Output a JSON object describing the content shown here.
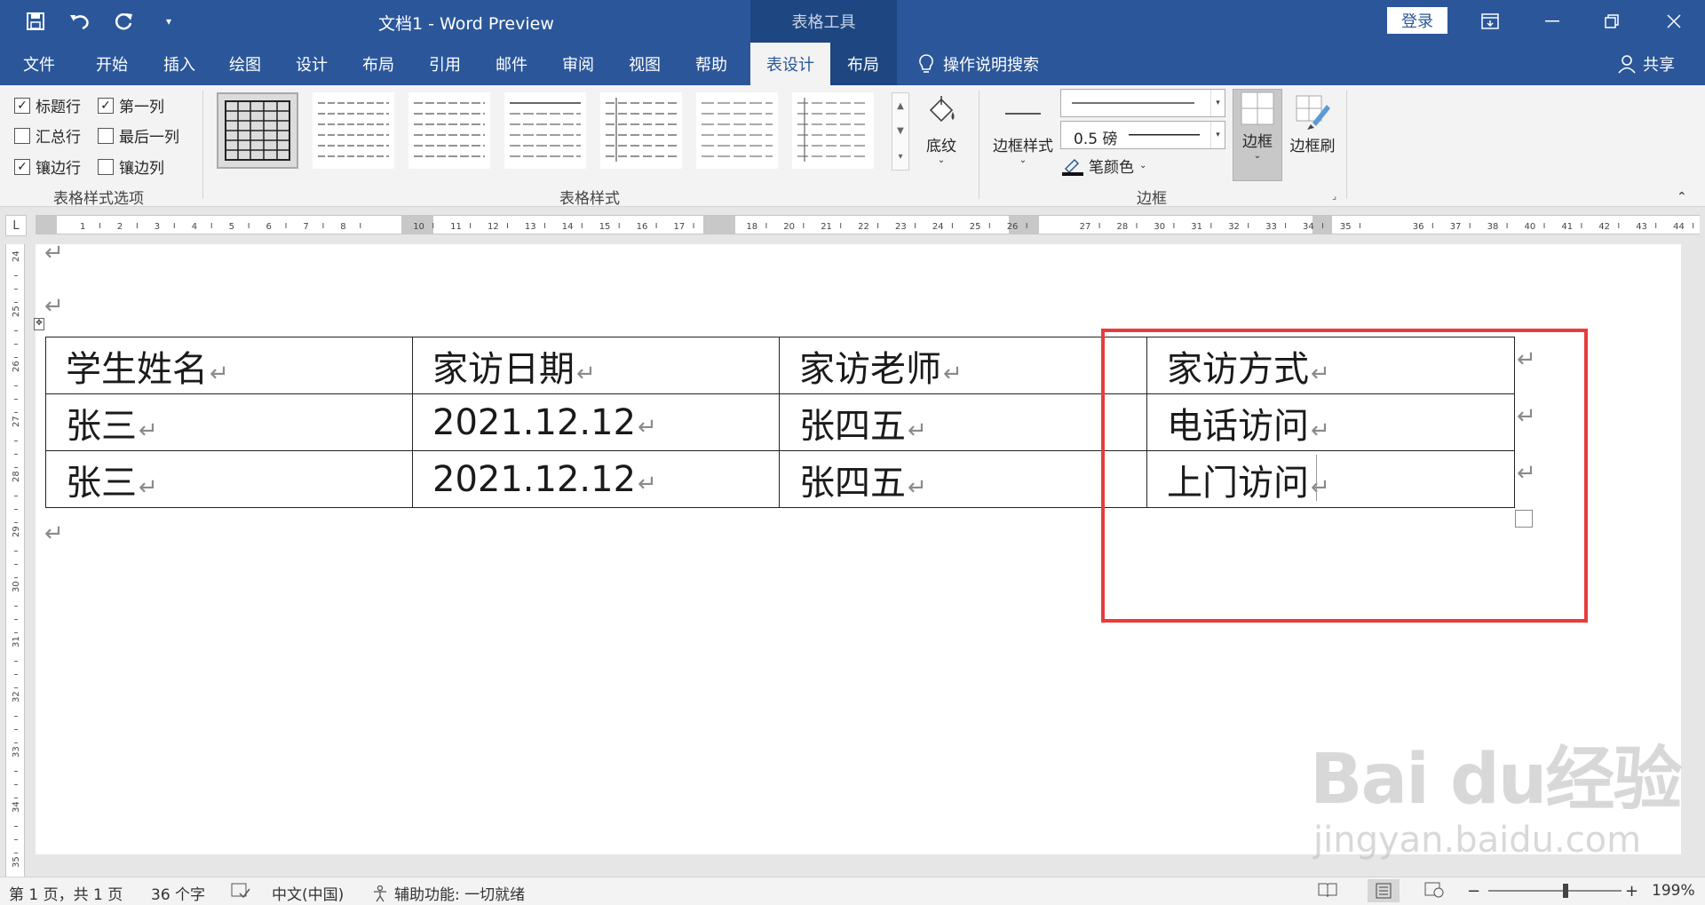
{
  "titlebar": {
    "doc_title": "文档1  -  Word Preview",
    "context_tab": "表格工具",
    "login": "登录",
    "qat_icons": [
      "save-icon",
      "undo-icon",
      "redo-icon",
      "customize-icon"
    ]
  },
  "tabs": [
    "文件",
    "开始",
    "插入",
    "绘图",
    "设计",
    "布局",
    "引用",
    "邮件",
    "审阅",
    "视图",
    "帮助",
    "表设计",
    "布局"
  ],
  "active_tab": "表设计",
  "tellme": "操作说明搜索",
  "share": "共享",
  "ribbon": {
    "style_options": {
      "label": "表格样式选项",
      "items": [
        {
          "label": "标题行",
          "checked": true
        },
        {
          "label": "第一列",
          "checked": true
        },
        {
          "label": "汇总行",
          "checked": false
        },
        {
          "label": "最后一列",
          "checked": false
        },
        {
          "label": "镶边行",
          "checked": true
        },
        {
          "label": "镶边列",
          "checked": false
        }
      ]
    },
    "table_styles": {
      "label": "表格样式",
      "shading": "底纹"
    },
    "borders": {
      "label": "边框",
      "border_styles": "边框样式",
      "weight": "0.5 磅",
      "pen_color": "笔颜色",
      "border_btn": "边框",
      "painter": "边框刷"
    }
  },
  "table": {
    "rows": [
      [
        "学生姓名",
        "家访日期",
        "家访老师",
        "家访方式"
      ],
      [
        "张三",
        "2021.12.12",
        "张四五",
        "电话访问"
      ],
      [
        "张三",
        "2021.12.12",
        "张四五",
        "上门访问"
      ]
    ]
  },
  "paragraph_mark": "↵",
  "ruler": {
    "h_ticks": [
      "1",
      "2",
      "3",
      "4",
      "5",
      "6",
      "7",
      "8",
      "10",
      "11",
      "12",
      "13",
      "14",
      "15",
      "16",
      "17",
      "18",
      "20",
      "21",
      "22",
      "23",
      "24",
      "25",
      "26",
      "27",
      "28",
      "30",
      "31",
      "32",
      "33",
      "34",
      "35",
      "36",
      "37",
      "38",
      "40",
      "41",
      "42",
      "43",
      "44"
    ],
    "v_ticks": [
      "24",
      "25",
      "26",
      "27",
      "28",
      "29",
      "30",
      "31",
      "32",
      "33",
      "34",
      "35"
    ]
  },
  "watermark": {
    "brand": "Bai du经验",
    "url": "jingyan.baidu.com"
  },
  "status": {
    "page": "第 1 页，共 1 页",
    "words": "36 个字",
    "lang": "中文(中国)",
    "accessibility": "辅助功能: 一切就绪",
    "zoom": "199%"
  }
}
